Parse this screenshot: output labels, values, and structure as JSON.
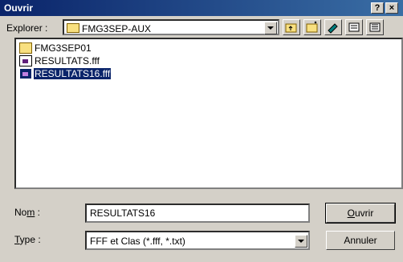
{
  "window": {
    "title": "Ouvrir",
    "help_button": "?",
    "close_button": "×"
  },
  "toolbar": {
    "explorer_label": "Explorer :",
    "current_folder": "FMG3SEP-AUX",
    "buttons": [
      "up-folder-icon",
      "new-folder-icon",
      "desktop-icon",
      "list-view-icon",
      "details-view-icon"
    ]
  },
  "files": [
    {
      "name": "FMG3SEP01",
      "type": "folder",
      "selected": false
    },
    {
      "name": "RESULTATS.fff",
      "type": "file",
      "selected": false
    },
    {
      "name": "RESULTATS16.fff",
      "type": "file",
      "selected": true
    }
  ],
  "form": {
    "name_label": "Nom :",
    "name_value": "RESULTATS16",
    "type_label": "Type :",
    "type_value": "FFF et Clas (*.fff, *.txt)"
  },
  "buttons": {
    "open": "Ouvrir",
    "cancel": "Annuler"
  }
}
